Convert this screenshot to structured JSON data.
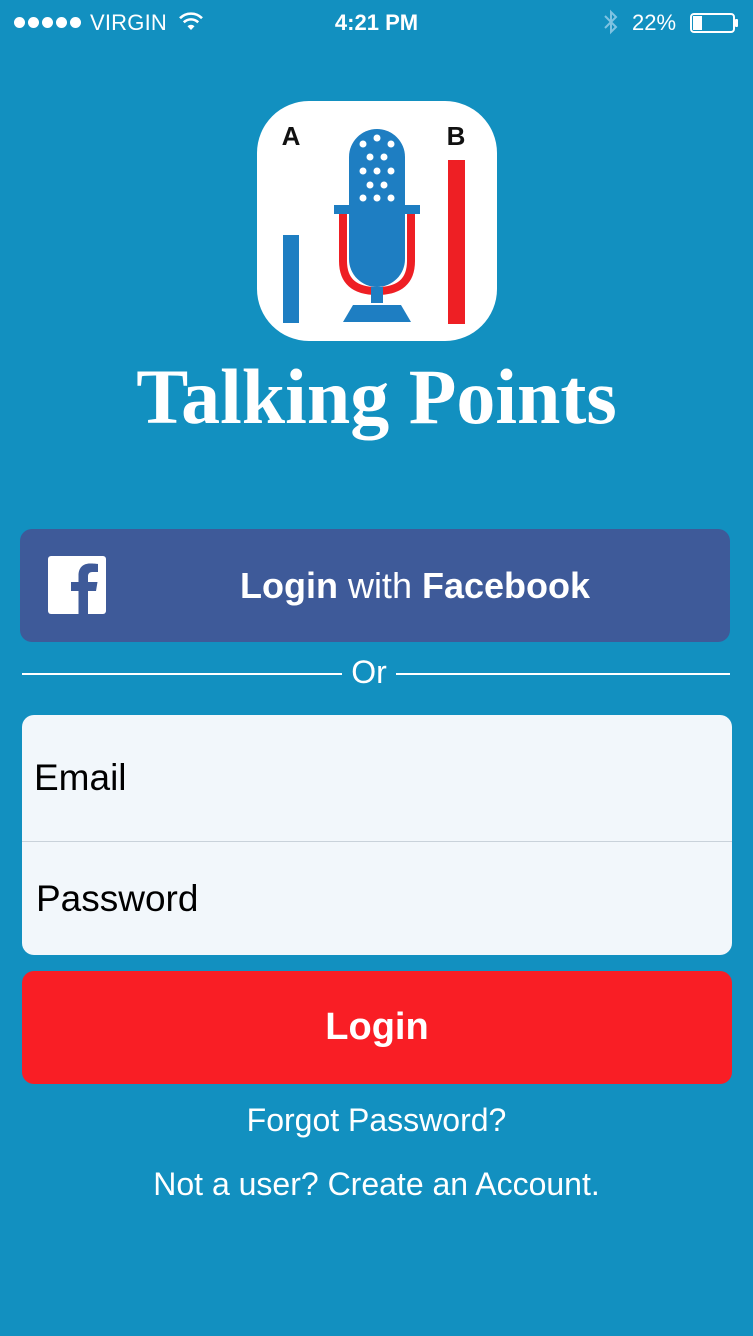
{
  "status_bar": {
    "carrier": "VIRGIN",
    "time": "4:21 PM",
    "battery_percent": "22%",
    "battery_level": 0.22,
    "signal_bars": 5,
    "icons": [
      "wifi-icon",
      "bluetooth-icon",
      "battery-icon"
    ]
  },
  "app": {
    "name": "Talking Points",
    "icon": {
      "name": "talking-points-app-icon",
      "letter_a": "A",
      "letter_b": "B"
    }
  },
  "facebook_login": {
    "icon": "facebook-icon",
    "label_part1": "Login",
    "label_part2": " with ",
    "label_part3": "Facebook"
  },
  "divider": {
    "text": "Or"
  },
  "form": {
    "email_placeholder": "Email",
    "password_placeholder": "Password"
  },
  "login_button": {
    "label": "Login"
  },
  "links": {
    "forgot_password": "Forgot Password?",
    "create_account": "Not a user? Create an Account."
  },
  "colors": {
    "background": "#1290c0",
    "facebook_blue": "#3e5a99",
    "login_red": "#f91e25",
    "input_background": "#f2f7fb",
    "icon_blue": "#1e7ec2",
    "icon_red": "#ee1f24"
  }
}
